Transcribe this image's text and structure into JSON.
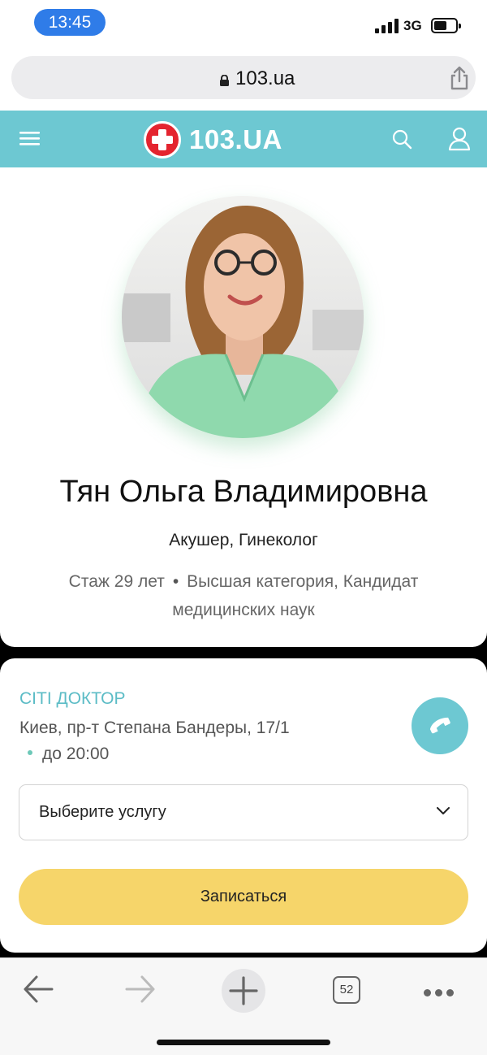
{
  "status_bar": {
    "time": "13:45",
    "network": "3G",
    "signal_icon": "cellular-signal-icon",
    "battery_icon": "battery-icon",
    "battery_level": 0.5
  },
  "address_bar": {
    "url": "103.ua",
    "lock_icon": "lock-icon",
    "share_icon": "share-icon"
  },
  "site_header": {
    "logo_text": "103.UA",
    "menu_icon": "hamburger-menu-icon",
    "search_icon": "search-icon",
    "user_icon": "user-icon",
    "background": "#6dc8d2",
    "logo_color": "#e4242f"
  },
  "doctor": {
    "name": "Тян Ольга Владимировна",
    "specialty": "Акушер, Гинеколог",
    "experience": "Стаж 29 лет",
    "separator": "•",
    "category": "Высшая категория, Кандидат медицинских наук"
  },
  "clinic": {
    "name": "СІТІ ДОКТОР",
    "address": "Киев, пр-т Степана Бандеры, 17/1",
    "hours": "до 20:00",
    "phone_icon": "phone-icon",
    "service_select": "Выберите услугу",
    "book_label": "Записаться",
    "accent_color": "#5cbcc6",
    "button_color": "#f6d56a"
  },
  "toolbar": {
    "back_icon": "back-arrow-icon",
    "forward_icon": "forward-arrow-icon",
    "new_tab_icon": "plus-icon",
    "tabs_count": "52",
    "more_icon": "more-dots-icon"
  }
}
